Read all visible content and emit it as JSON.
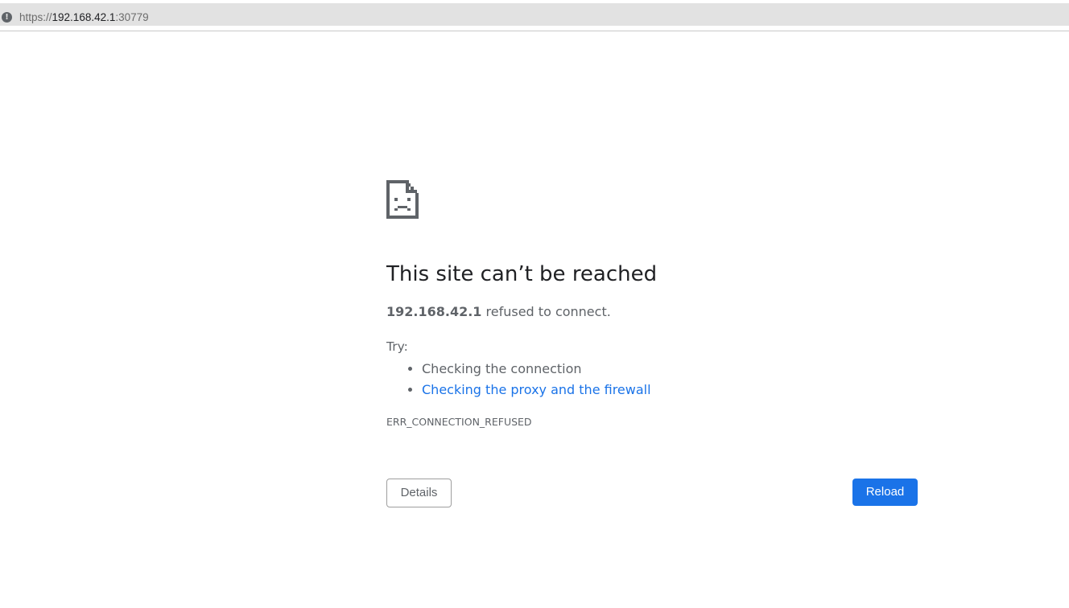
{
  "address_bar": {
    "scheme": "https://",
    "host": "192.168.42.1",
    "port": ":30779",
    "icon": "warning-icon"
  },
  "error_page": {
    "icon": "sad-page-icon",
    "title": "This site can’t be reached",
    "host": "192.168.42.1",
    "message": " refused to connect.",
    "try_label": "Try:",
    "suggestions": [
      "Checking the connection",
      "Checking the proxy and the firewall"
    ],
    "error_code": "ERR_CONNECTION_REFUSED",
    "details_label": "Details",
    "reload_label": "Reload"
  },
  "colors": {
    "accent": "#1a73e8",
    "text": "#5f6368",
    "title": "#202124"
  }
}
